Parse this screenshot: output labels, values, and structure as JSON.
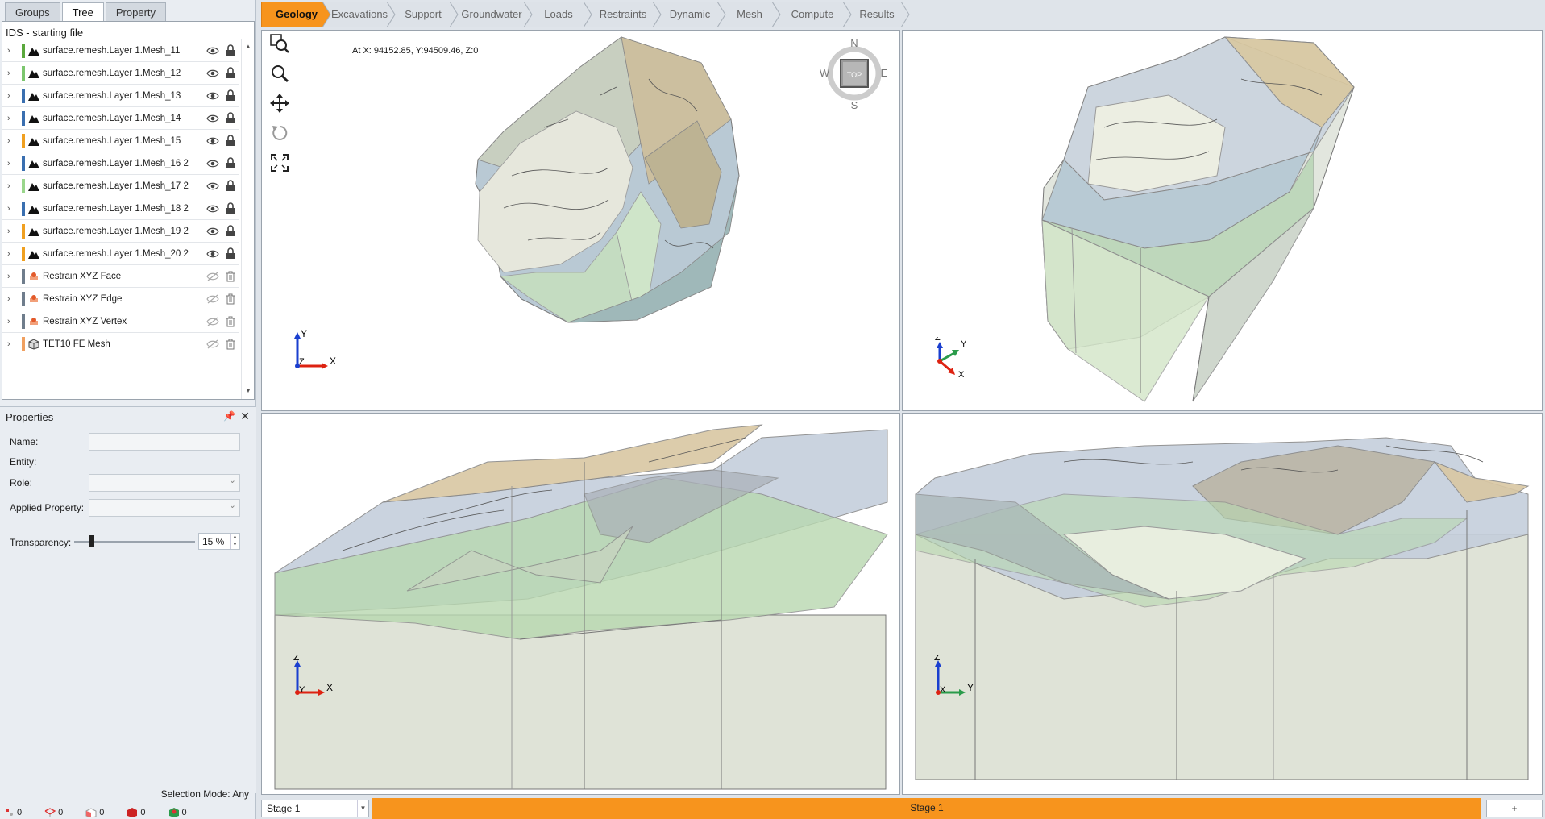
{
  "left_tabs": [
    "Groups",
    "Tree",
    "Property"
  ],
  "tree": {
    "title": "IDS - starting file",
    "items": [
      {
        "label": "surface.remesh.Layer 1.Mesh_11",
        "color": "#5aa83c"
      },
      {
        "label": "surface.remesh.Layer 1.Mesh_12",
        "color": "#7cc66e"
      },
      {
        "label": "surface.remesh.Layer 1.Mesh_13",
        "color": "#3a6fb0"
      },
      {
        "label": "surface.remesh.Layer 1.Mesh_14",
        "color": "#3a6fb0"
      },
      {
        "label": "surface.remesh.Layer 1.Mesh_15",
        "color": "#f0a020"
      },
      {
        "label": "surface.remesh.Layer 1.Mesh_16 2",
        "color": "#3a6fb0"
      },
      {
        "label": "surface.remesh.Layer 1.Mesh_17 2",
        "color": "#9ad68c"
      },
      {
        "label": "surface.remesh.Layer 1.Mesh_18 2",
        "color": "#3a6fb0"
      },
      {
        "label": "surface.remesh.Layer 1.Mesh_19 2",
        "color": "#f0a020"
      },
      {
        "label": "surface.remesh.Layer 1.Mesh_20 2",
        "color": "#f0a020"
      },
      {
        "label": "Restrain XYZ Face",
        "color": "#6f7d8c"
      },
      {
        "label": "Restrain XYZ Edge",
        "color": "#6f7d8c"
      },
      {
        "label": "Restrain XYZ Vertex",
        "color": "#6f7d8c"
      },
      {
        "label": "TET10 FE Mesh",
        "color": "#f0a060"
      }
    ]
  },
  "properties": {
    "title": "Properties",
    "name_label": "Name:",
    "entity_label": "Entity:",
    "role_label": "Role:",
    "applied_label": "Applied Property:",
    "transparency_label": "Transparency:",
    "transparency_value": "15 %"
  },
  "selection_mode": "Selection Mode: Any",
  "status_counts": [
    "0",
    "0",
    "0",
    "0",
    "0"
  ],
  "ribbon": [
    "Geology",
    "Excavations",
    "Support",
    "Groundwater",
    "Loads",
    "Restraints",
    "Dynamic",
    "Mesh",
    "Compute",
    "Results"
  ],
  "viewport": {
    "coords": "At X: 94152.85, Y:94509.46, Z:0",
    "compass": {
      "n": "N",
      "s": "S",
      "e": "E",
      "w": "W",
      "top": "TOP"
    },
    "axes_top": {
      "a": "Y",
      "b": "Z",
      "c": "X"
    },
    "axes_persp": {
      "a": "Z",
      "b": "Y",
      "c": "X"
    },
    "axes_front": {
      "a": "Z",
      "b": "Y",
      "c": "X"
    },
    "axes_side": {
      "a": "Z",
      "b": "X",
      "c": "Y"
    }
  },
  "stage": {
    "select": "Stage 1",
    "main": "Stage 1",
    "add": "+"
  },
  "colors": {
    "accent": "#f7941d",
    "gray_panel": "#e9edf2"
  }
}
